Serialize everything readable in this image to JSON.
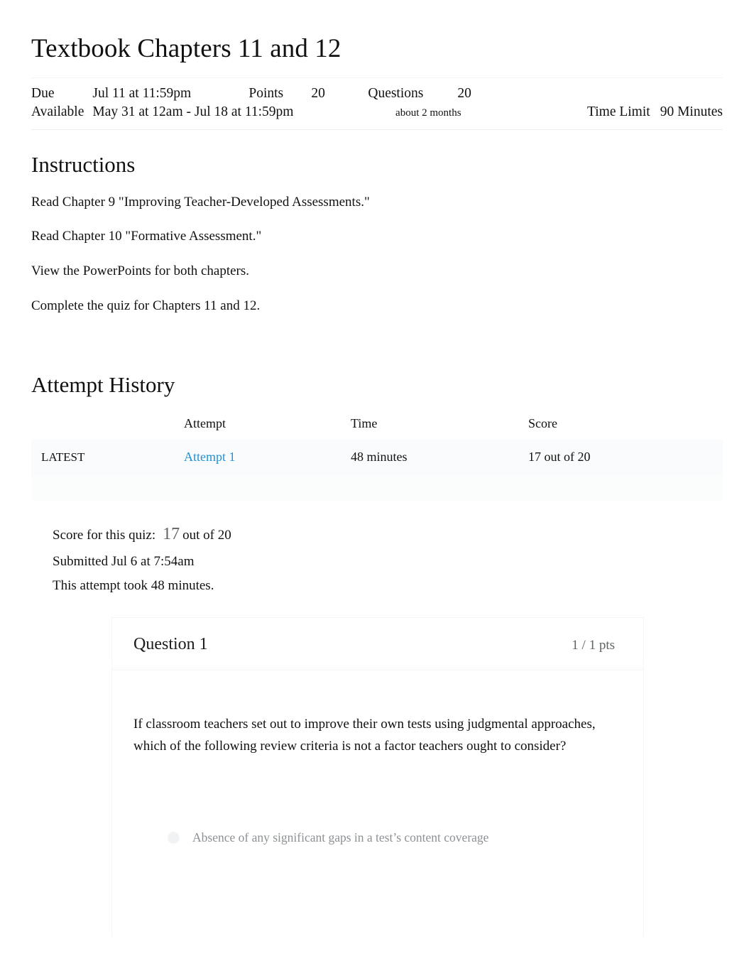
{
  "quiz": {
    "title": "Textbook Chapters 11 and 12"
  },
  "meta": {
    "due_label": "Due",
    "due_value": "Jul 11 at 11:59pm",
    "points_label": "Points",
    "points_value": "20",
    "questions_label": "Questions",
    "questions_value": "20",
    "available_label": "Available",
    "available_value": "May 31 at 12am - Jul 18 at 11:59pm",
    "duration_note": "about 2 months",
    "time_limit_label": "Time Limit",
    "time_limit_value": "90 Minutes"
  },
  "instructions": {
    "heading": "Instructions",
    "paragraphs": [
      "Read Chapter 9 \"Improving Teacher-Developed Assessments.\"",
      "Read Chapter 10 \"Formative Assessment.\"",
      "View the PowerPoints for both chapters.",
      "Complete the quiz for Chapters 11 and 12."
    ]
  },
  "attempt_history": {
    "heading": "Attempt History",
    "columns": [
      "",
      "Attempt",
      "Time",
      "Score"
    ],
    "rows": [
      {
        "tag": "LATEST",
        "attempt": "Attempt 1",
        "time": "48 minutes",
        "score": "17 out of 20"
      }
    ]
  },
  "score_summary": {
    "score_label": "Score for this quiz:",
    "score_value": "17",
    "score_out_of": "out of 20",
    "submitted": "Submitted Jul 6 at 7:54am",
    "duration": "This attempt took 48 minutes."
  },
  "question": {
    "name": "Question 1",
    "points": "1 / 1 pts",
    "text": "If classroom teachers set out to improve their own tests using judgmental approaches, which of the following review criteria is not a factor teachers ought to consider?",
    "answers": [
      {
        "text": "Absence of any significant gaps in a test’s content coverage"
      }
    ]
  },
  "colors": {
    "link": "#1f91d4",
    "text": "#111111",
    "muted": "#8d9194",
    "points_gray": "#5e6466"
  }
}
